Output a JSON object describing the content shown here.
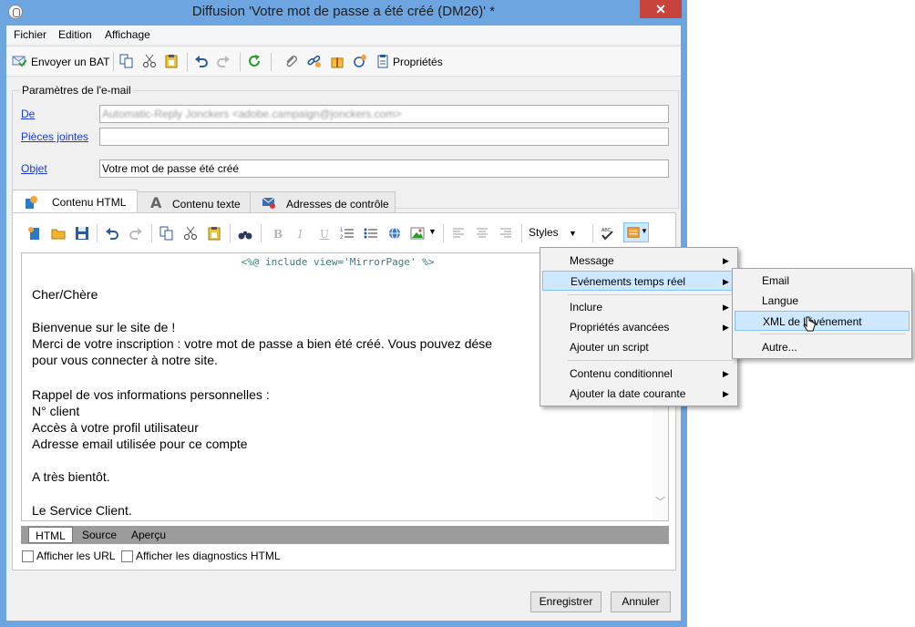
{
  "window": {
    "title": "Diffusion 'Votre mot de passe a été créé (DM26)' *",
    "close_glyph": "✕"
  },
  "menubar": [
    "Fichier",
    "Edition",
    "Affichage"
  ],
  "toolbar": {
    "send_bat_label": "Envoyer un BAT",
    "properties_label": "Propriétés"
  },
  "params": {
    "legend": "Paramètres de l'e-mail",
    "from_label": "De",
    "from_value": "Automatic-Reply Jonckers <adobe.campaign@jonckers.com>",
    "attachments_label": "Pièces jointes",
    "attachments_value": "",
    "subject_label": "Objet",
    "subject_value": "Votre mot de passe été créé"
  },
  "tabs": [
    {
      "label": "Contenu HTML",
      "active": true
    },
    {
      "label": "Contenu texte",
      "active": false
    },
    {
      "label": "Adresses de contrôle",
      "active": false
    }
  ],
  "editor_toolbar": {
    "bold": "B",
    "italic": "I",
    "underline": "U",
    "styles_label": "Styles"
  },
  "editor": {
    "include_line": "<%@ include view='MirrorPage' %>",
    "lines": [
      "Cher/Chère",
      "",
      "Bienvenue sur le site de  !",
      "Merci de votre inscription : votre mot de passe a bien été créé. Vous pouvez dése",
      "pour vous connecter à notre site.",
      "",
      "Rappel de vos informations personnelles :",
      "N° client",
      "Accès à votre profil utilisateur",
      "Adresse email utilisée pour ce compte",
      "",
      "A très bientôt.",
      "",
      "Le Service Client."
    ]
  },
  "editor_tabs": [
    "HTML",
    "Source",
    "Aperçu"
  ],
  "checkboxes": [
    {
      "label": "Afficher les URL",
      "checked": false
    },
    {
      "label": "Afficher les diagnostics HTML",
      "checked": false
    }
  ],
  "buttons": {
    "save": "Enregistrer",
    "cancel": "Annuler"
  },
  "context_menu": {
    "items": [
      "Message",
      "Evénements temps réel",
      "Inclure",
      "Propriétés avancées",
      "Ajouter un script",
      "Contenu conditionnel",
      "Ajouter la date courante"
    ],
    "highlighted": "Evénements temps réel"
  },
  "submenu": {
    "items": [
      "Email",
      "Langue",
      "XML de l'événement",
      "Autre..."
    ],
    "highlighted": "XML de l'événement"
  },
  "colors": {
    "title_bar": "#6ca5e0",
    "close_button": "#c7433b",
    "menu_highlight": "#cde8ff",
    "link": "#1a3ad6"
  }
}
